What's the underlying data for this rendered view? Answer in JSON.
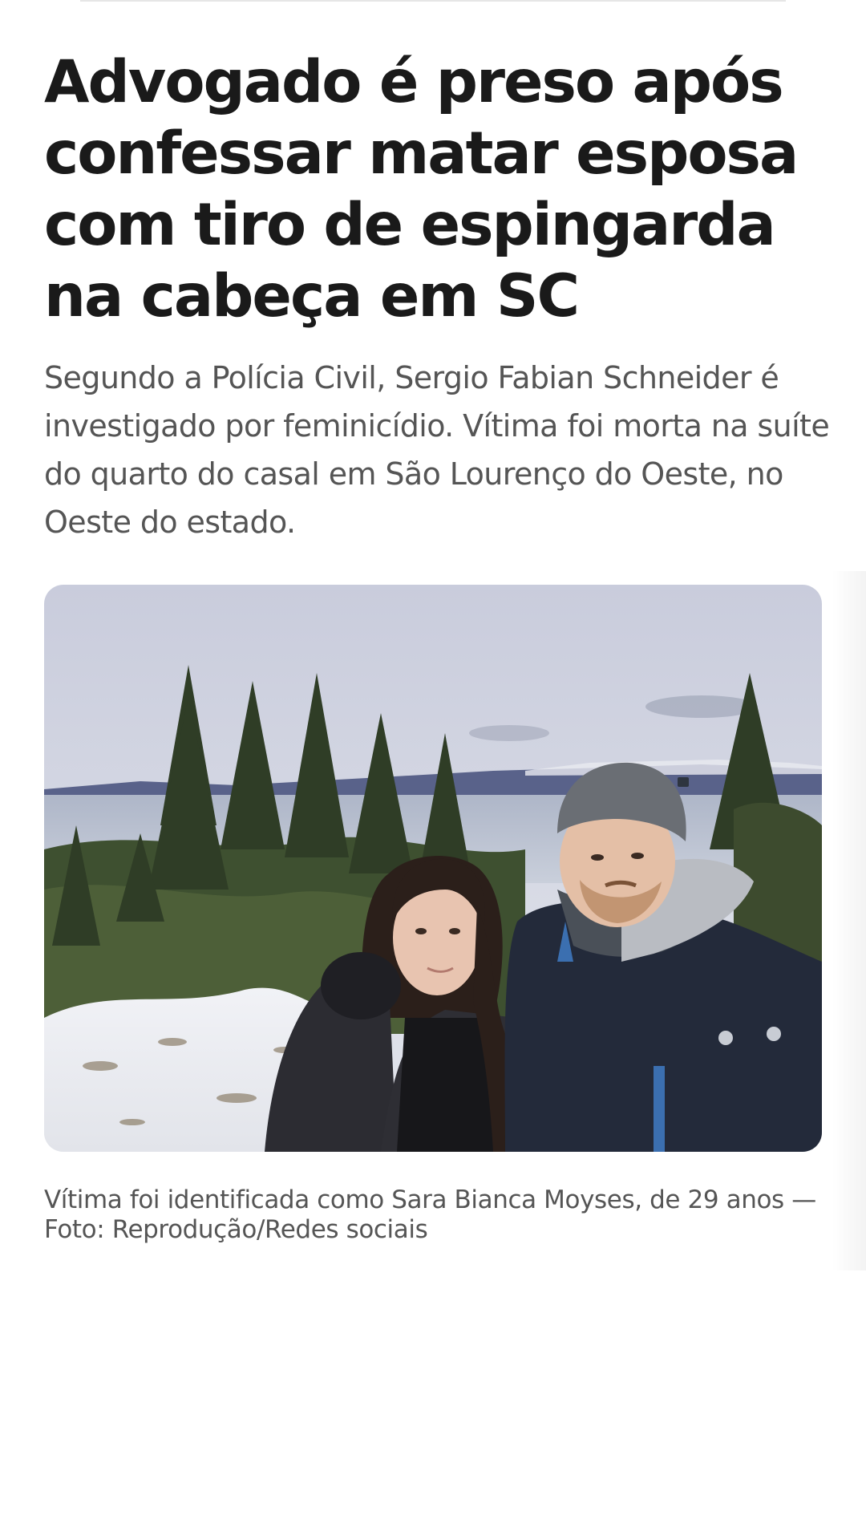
{
  "article": {
    "headline": "Advogado é preso após confessar matar esposa com tiro de espingarda na cabeça em SC",
    "subtitle": "Segundo a Polícia Civil, Sergio Fabian Schneider é investigado por feminicídio. Vítima foi morta na suíte do quarto do casal em São Lourenço do Oeste, no Oeste do estado.",
    "photo": {
      "caption": "Vítima foi identificada como Sara Bianca Moyses, de 29 anos — Foto: Reprodução/Redes sociais"
    }
  }
}
